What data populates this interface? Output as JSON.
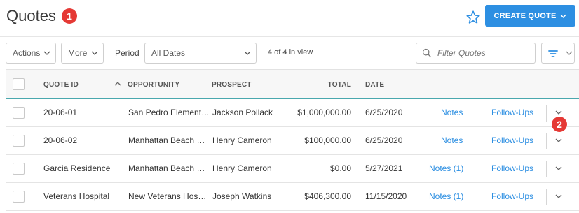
{
  "header": {
    "title": "Quotes",
    "badge_1": "1",
    "create_button": "CREATE QUOTE"
  },
  "toolbar": {
    "actions_label": "Actions",
    "more_label": "More",
    "period_label": "Period",
    "period_value": "All Dates",
    "in_view": "4 of 4 in view",
    "filter_placeholder": "Filter Quotes"
  },
  "table": {
    "columns": {
      "quote_id": "QUOTE ID",
      "opportunity": "OPPORTUNITY",
      "prospect": "PROSPECT",
      "total": "TOTAL",
      "date": "DATE"
    },
    "rows": [
      {
        "quote_id": "20-06-01",
        "opportunity": "San Pedro Element…",
        "prospect": "Jackson Pollack",
        "total": "$1,000,000.00",
        "date": "6/25/2020",
        "notes": "Notes",
        "followups": "Follow-Ups"
      },
      {
        "quote_id": "20-06-02",
        "opportunity": "Manhattan Beach …",
        "prospect": "Henry Cameron",
        "total": "$100,000.00",
        "date": "6/25/2020",
        "notes": "Notes",
        "followups": "Follow-Ups"
      },
      {
        "quote_id": "Garcia Residence",
        "opportunity": "Manhattan Beach …",
        "prospect": "Henry Cameron",
        "total": "$0.00",
        "date": "5/27/2021",
        "notes": "Notes (1)",
        "followups": "Follow-Ups"
      },
      {
        "quote_id": "Veterans Hospital",
        "opportunity": "New Veterans Hos…",
        "prospect": "Joseph Watkins",
        "total": "$406,300.00",
        "date": "11/15/2020",
        "notes": "Notes (1)",
        "followups": "Follow-Ups"
      }
    ]
  },
  "badge_2": "2",
  "colors": {
    "accent": "#2d8fe2",
    "badge": "#e53935",
    "header_underline": "#4aa8ae"
  },
  "icons": [
    "star-icon",
    "chevron-down-icon",
    "search-icon",
    "filter-icon",
    "sort-ascending-icon"
  ]
}
